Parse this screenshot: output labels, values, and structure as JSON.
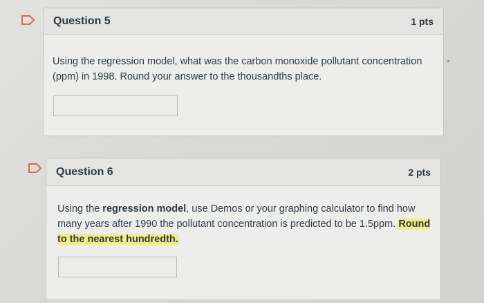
{
  "colors": {
    "page_background": "#dadad8",
    "card_background": "#ededeb",
    "header_background": "#e4e4e2",
    "highlight": "#f3ee82",
    "flag_border": "#e06a4a",
    "text": "#2d3b45"
  },
  "questions": [
    {
      "title": "Question 5",
      "points": "1 pts",
      "text": "Using the regression model, what was the carbon monoxide pollutant concentration (ppm) in 1998. Round your answer to the thousandths place.",
      "answer_value": "",
      "flag_icon": "flag-icon"
    },
    {
      "title": "Question 6",
      "points": "2 pts",
      "text_part1": "Using the ",
      "text_bold": "regression model",
      "text_part2": ", use Demos or your graphing calculator to find how many years after 1990 the pollutant concentration is predicted to be 1.5ppm. ",
      "text_highlight": "Round to the nearest hundredth.",
      "answer_value": "",
      "flag_icon": "flag-icon"
    }
  ]
}
